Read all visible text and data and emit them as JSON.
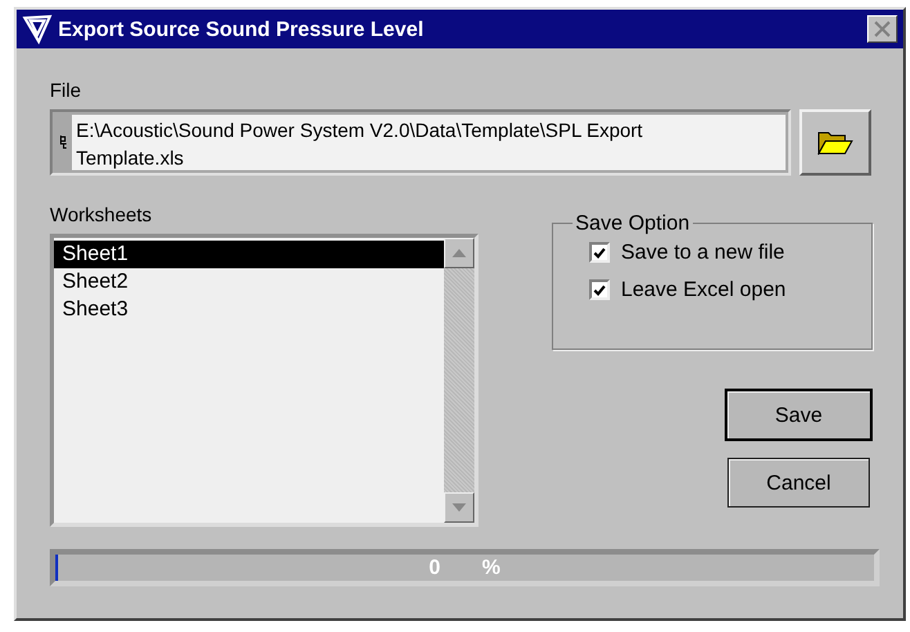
{
  "window": {
    "title": "Export Source Sound Pressure Level"
  },
  "file": {
    "label": "File",
    "value": "E:\\Acoustic\\Sound Power System V2.0\\Data\\Template\\SPL Export Template.xls"
  },
  "worksheets": {
    "label": "Worksheets",
    "items": [
      {
        "name": "Sheet1",
        "selected": true
      },
      {
        "name": "Sheet2",
        "selected": false
      },
      {
        "name": "Sheet3",
        "selected": false
      }
    ]
  },
  "save_option": {
    "title": "Save Option",
    "options": [
      {
        "label": "Save to a new file",
        "checked": true
      },
      {
        "label": "Leave Excel open",
        "checked": true
      }
    ]
  },
  "buttons": [
    {
      "label": "Save",
      "default": true
    },
    {
      "label": "Cancel",
      "default": false
    }
  ],
  "progress": {
    "level": 0.004,
    "value": "0",
    "unit": "%"
  }
}
